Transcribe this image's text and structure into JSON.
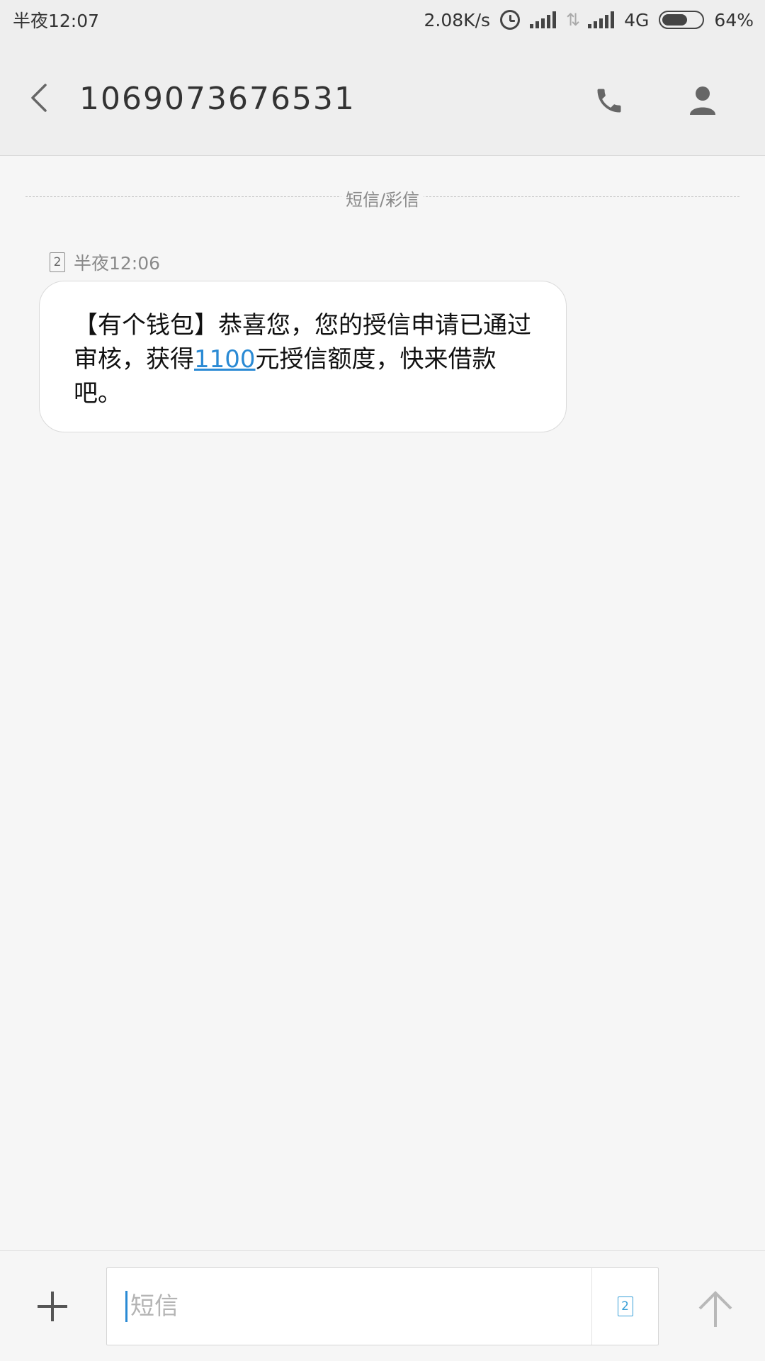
{
  "status_bar": {
    "time": "半夜12:07",
    "net_speed": "2.08K/s",
    "network_type": "4G",
    "battery_percent_label": "64%",
    "battery_level": 0.64
  },
  "header": {
    "title": "1069073676531",
    "icons": {
      "back": "chevron-left-icon",
      "call": "phone-icon",
      "contact": "person-icon"
    }
  },
  "conversation": {
    "divider_label": "短信/彩信",
    "messages": [
      {
        "sim": "2",
        "timestamp": "半夜12:06",
        "text_before_link": "【有个钱包】恭喜您，您的授信申请已通过审核，获得",
        "link_text": "1100",
        "text_after_link": "元授信额度，快来借款吧。"
      }
    ]
  },
  "composer": {
    "placeholder": "短信",
    "sim_label": "2",
    "icons": {
      "add": "plus-icon",
      "send": "arrow-up-icon"
    }
  },
  "colors": {
    "accent": "#2a8ad4",
    "header_bg": "#eeeeee",
    "page_bg": "#f6f6f6"
  }
}
